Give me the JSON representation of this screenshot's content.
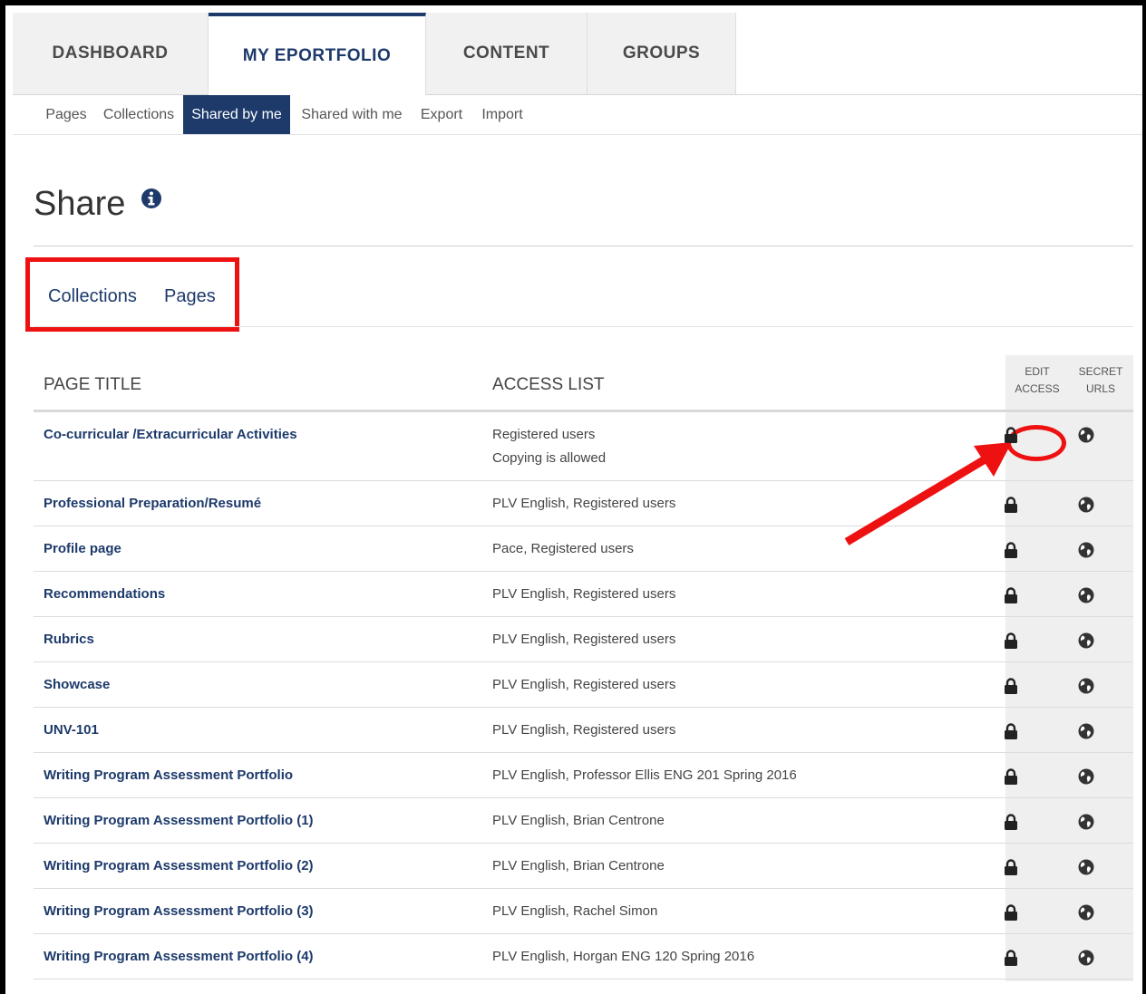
{
  "nav": {
    "tabs": [
      {
        "label": "DASHBOARD"
      },
      {
        "label": "MY EPORTFOLIO"
      },
      {
        "label": "CONTENT"
      },
      {
        "label": "GROUPS"
      }
    ],
    "active_tab": "MY EPORTFOLIO"
  },
  "subnav": {
    "items": [
      {
        "label": "Pages"
      },
      {
        "label": "Collections"
      },
      {
        "label": "Shared by me"
      },
      {
        "label": "Shared with me"
      },
      {
        "label": "Export"
      },
      {
        "label": "Import"
      }
    ],
    "active": "Shared by me"
  },
  "page": {
    "title": "Share",
    "info_icon": "info-icon"
  },
  "share_tabs": [
    {
      "label": "Collections"
    },
    {
      "label": "Pages"
    }
  ],
  "table": {
    "headers": {
      "title": "PAGE TITLE",
      "access": "ACCESS LIST",
      "edit_access_1": "EDIT",
      "edit_access_2": "ACCESS",
      "secret_urls_1": "SECRET",
      "secret_urls_2": "URLS"
    },
    "rows": [
      {
        "title": "Co-curricular /Extracurricular Activities",
        "access": "Registered users",
        "access_note": "Copying is allowed"
      },
      {
        "title": "Professional Preparation/Resumé",
        "access": "PLV English, Registered users"
      },
      {
        "title": "Profile page",
        "access": "Pace, Registered users"
      },
      {
        "title": "Recommendations",
        "access": "PLV English, Registered users"
      },
      {
        "title": "Rubrics",
        "access": "PLV English, Registered users"
      },
      {
        "title": "Showcase",
        "access": "PLV English, Registered users"
      },
      {
        "title": "UNV-101",
        "access": "PLV English, Registered users"
      },
      {
        "title": "Writing Program Assessment Portfolio",
        "access": "PLV English, Professor Ellis ENG 201 Spring 2016"
      },
      {
        "title": "Writing Program Assessment Portfolio (1)",
        "access": "PLV English, Brian Centrone"
      },
      {
        "title": "Writing Program Assessment Portfolio (2)",
        "access": "PLV English, Brian Centrone"
      },
      {
        "title": "Writing Program Assessment Portfolio (3)",
        "access": "PLV English, Rachel Simon"
      },
      {
        "title": "Writing Program Assessment Portfolio (4)",
        "access": "PLV English, Horgan ENG 120 Spring 2016"
      }
    ],
    "action_icons": [
      "lock-icon",
      "globe-icon"
    ]
  },
  "colors": {
    "brand": "#1d3a6b",
    "annotation": "#ee1111"
  }
}
